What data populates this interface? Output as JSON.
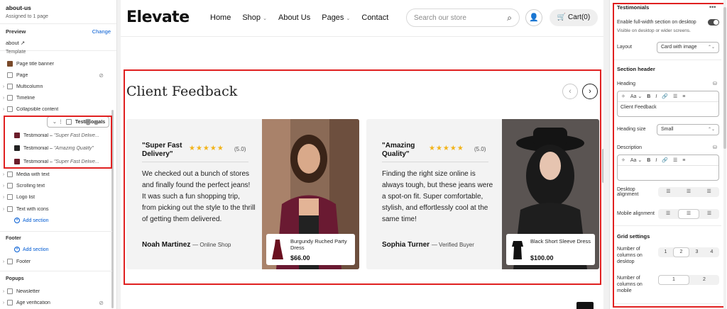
{
  "sidebar": {
    "title": "about-us",
    "subtitle": "Assigned to 1 page",
    "preview_label": "Preview",
    "change_link": "Change",
    "preview_value": "about",
    "template_label": "Template",
    "items": [
      {
        "label": "Page title banner"
      },
      {
        "label": "Page"
      },
      {
        "label": "Multicolumn"
      },
      {
        "label": "Timeline"
      },
      {
        "label": "Collapsible content"
      },
      {
        "label": "Testimonials"
      },
      {
        "label": "Testimonial",
        "detail": "\"Super Fast Delive..."
      },
      {
        "label": "Testimonial",
        "detail": "\"Amazing Quality\""
      },
      {
        "label": "Testimonial",
        "detail": "\"Super Fast Delive..."
      },
      {
        "label": "Media with text"
      },
      {
        "label": "Scrolling text"
      },
      {
        "label": "Logo list"
      },
      {
        "label": "Text with icons"
      }
    ],
    "add_section": "Add section",
    "footer_label": "Footer",
    "footer_add": "Add section",
    "footer_item": "Footer",
    "popups_label": "Popups",
    "popup_items": [
      "Newsletter",
      "Age verification"
    ]
  },
  "store": {
    "logo": "Elevate",
    "menu": [
      "Home",
      "Shop",
      "About Us",
      "Pages",
      "Contact"
    ],
    "search_placeholder": "Search our store",
    "cart": "Cart(0)",
    "section_title": "Client Feedback",
    "cards": [
      {
        "quote": "\"Super Fast Delivery\"",
        "stars": "★★★★★",
        "rating": "(5.0)",
        "text": "We checked out a bunch of stores and finally found the perfect jeans! It was such a fun shopping trip, from picking out the style to the thrill of getting them delivered.",
        "author": "Noah Martinez",
        "author_role": "— Online Shop",
        "product_name": "Burgundy Ruched Party Dress",
        "product_price": "$66.00"
      },
      {
        "quote": "\"Amazing Quality\"",
        "stars": "★★★★★",
        "rating": "(5.0)",
        "text": "Finding the right size online is always tough, but these jeans were a spot-on fit. Super comfortable, stylish, and effortlessly cool at the same time!",
        "author": "Sophia Turner",
        "author_role": "— Verified Buyer",
        "product_name": "Black Short Sleeve Dress",
        "product_price": "$100.00"
      }
    ]
  },
  "settings": {
    "title": "Testimonials",
    "full_width_label": "Enable full-width section on desktop",
    "full_width_help": "Visible on desktop or wider screens.",
    "layout_label": "Layout",
    "layout_value": "Card with image",
    "section_header": "Section header",
    "heading_label": "Heading",
    "heading_value": "Client Feedback",
    "heading_size_label": "Heading size",
    "heading_size_value": "Small",
    "description_label": "Description",
    "desktop_alignment_label": "Desktop alignment",
    "mobile_alignment_label": "Mobile alignment",
    "grid_settings": "Grid settings",
    "cols_desktop_label": "Number of columns on desktop",
    "cols_desktop_options": [
      "1",
      "2",
      "3",
      "4"
    ],
    "cols_mobile_label": "Number of columns on mobile",
    "cols_mobile_options": [
      "1",
      "2"
    ]
  }
}
